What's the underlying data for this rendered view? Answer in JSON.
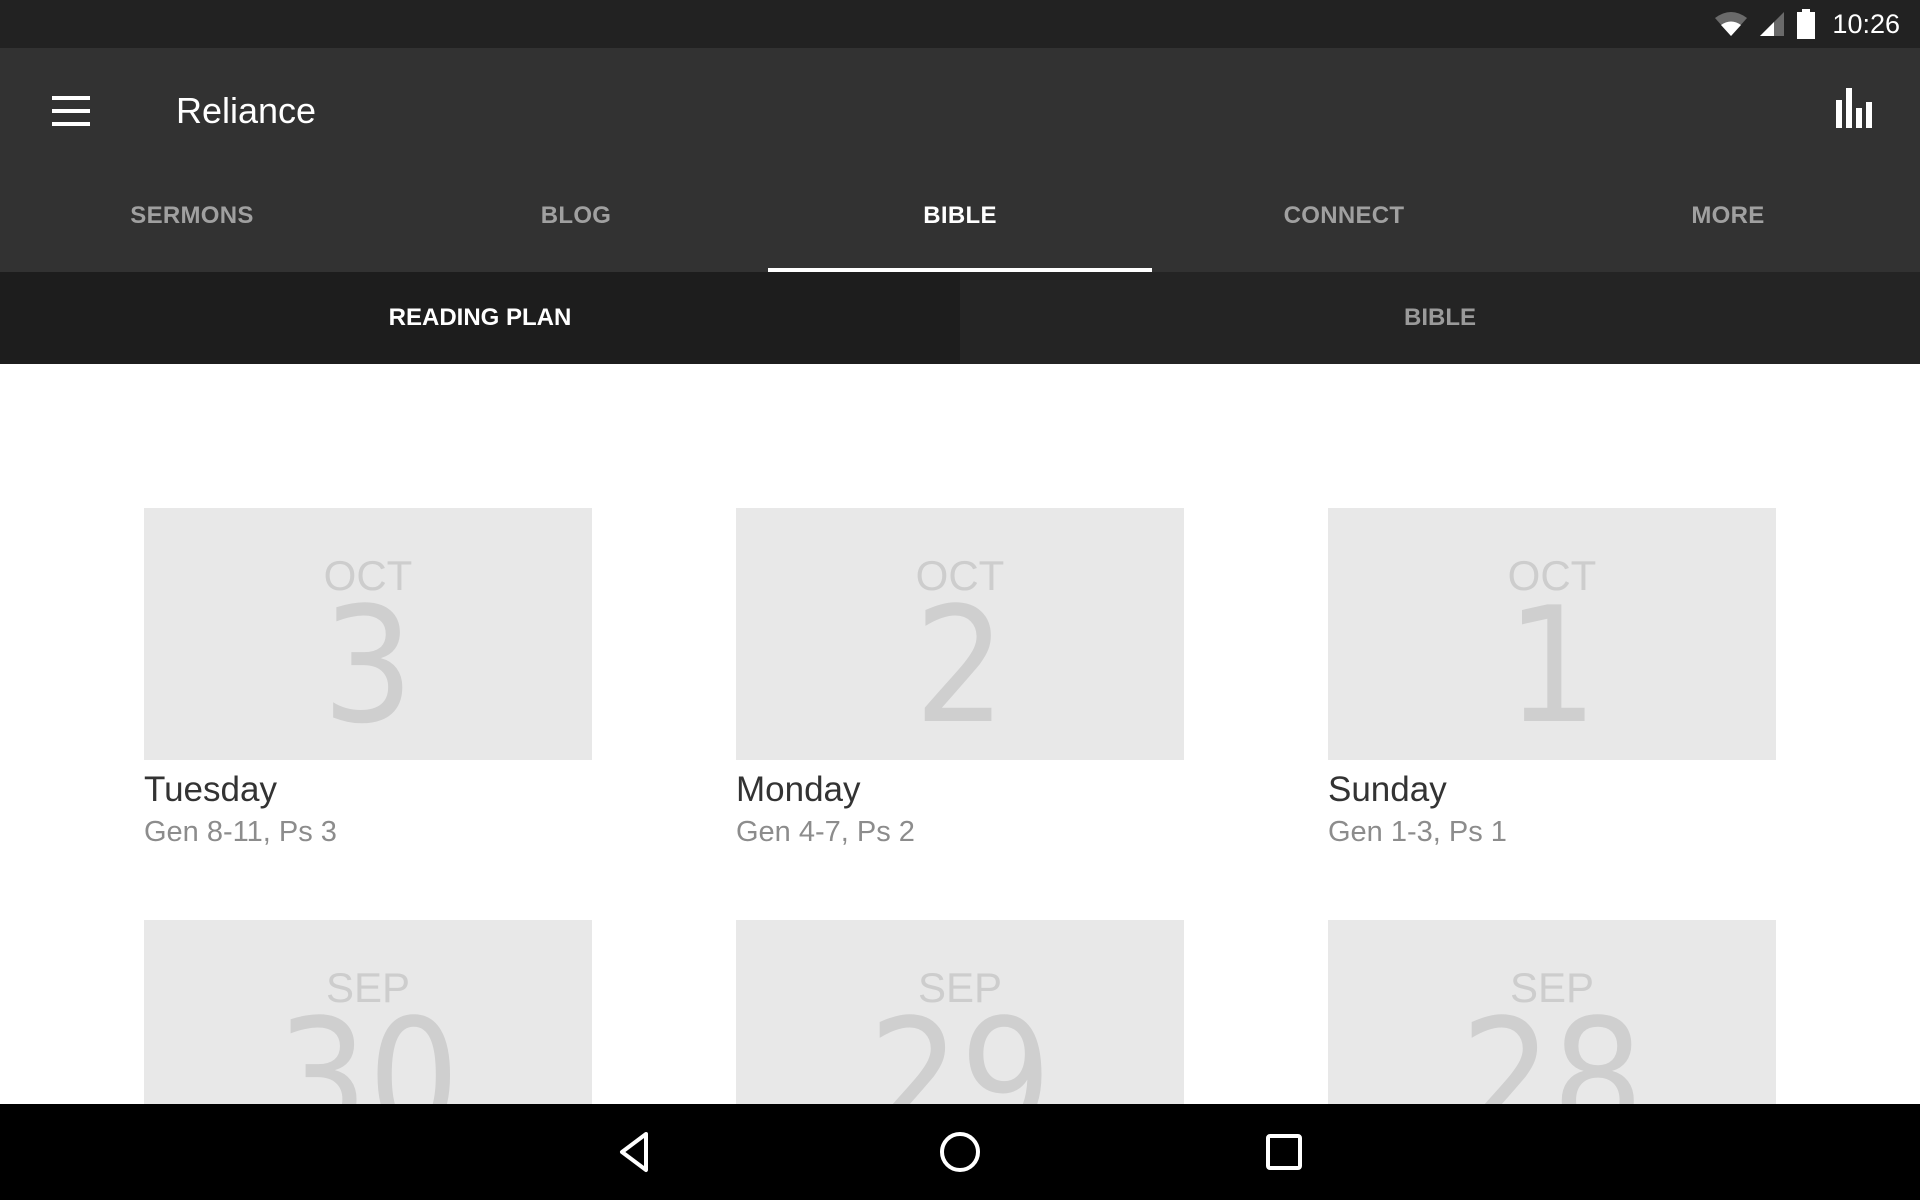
{
  "status_bar": {
    "time": "10:26",
    "icons": [
      "wifi-icon",
      "cell-signal-icon",
      "battery-icon"
    ]
  },
  "app_bar": {
    "title": "Reliance",
    "menu_icon": "hamburger-menu-icon",
    "action_icon": "bar-chart-icon"
  },
  "tabs": [
    {
      "label": "SERMONS",
      "active": false
    },
    {
      "label": "BLOG",
      "active": false
    },
    {
      "label": "BIBLE",
      "active": true
    },
    {
      "label": "CONNECT",
      "active": false
    },
    {
      "label": "MORE",
      "active": false
    }
  ],
  "subtabs": [
    {
      "label": "READING PLAN",
      "active": true
    },
    {
      "label": "BIBLE",
      "active": false
    }
  ],
  "readings": [
    {
      "month": "OCT",
      "day": "3",
      "weekday": "Tuesday",
      "passage": "Gen 8-11, Ps 3"
    },
    {
      "month": "OCT",
      "day": "2",
      "weekday": "Monday",
      "passage": "Gen 4-7, Ps 2"
    },
    {
      "month": "OCT",
      "day": "1",
      "weekday": "Sunday",
      "passage": "Gen 1-3, Ps 1"
    },
    {
      "month": "SEP",
      "day": "30",
      "weekday": "",
      "passage": ""
    },
    {
      "month": "SEP",
      "day": "29",
      "weekday": "",
      "passage": ""
    },
    {
      "month": "SEP",
      "day": "28",
      "weekday": "",
      "passage": ""
    }
  ],
  "nav_bar": {
    "buttons": [
      "back-icon",
      "home-icon",
      "recents-icon"
    ]
  }
}
